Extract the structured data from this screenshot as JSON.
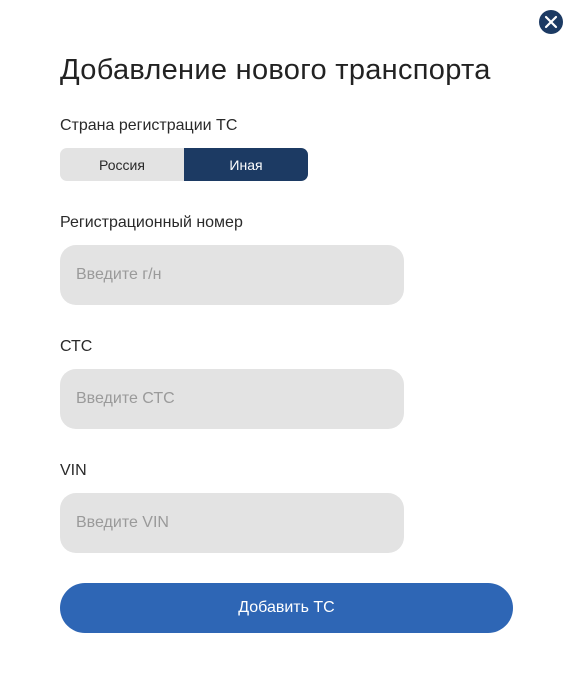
{
  "modal": {
    "title": "Добавление нового транспорта",
    "close_icon": "close-icon"
  },
  "country": {
    "label": "Страна регистрации ТС",
    "options": [
      "Россия",
      "Иная"
    ],
    "selected": "Иная"
  },
  "reg_number": {
    "label": "Регистрационный номер",
    "value": "",
    "placeholder": "Введите г/н"
  },
  "sts": {
    "label": "СТС",
    "value": "",
    "placeholder": "Введите СТС"
  },
  "vin": {
    "label": "VIN",
    "value": "",
    "placeholder": "Введите VIN"
  },
  "submit": {
    "label": "Добавить ТС"
  },
  "colors": {
    "accent_dark": "#1c3a63",
    "button_blue": "#2e66b5",
    "field_bg": "#e3e3e3"
  }
}
